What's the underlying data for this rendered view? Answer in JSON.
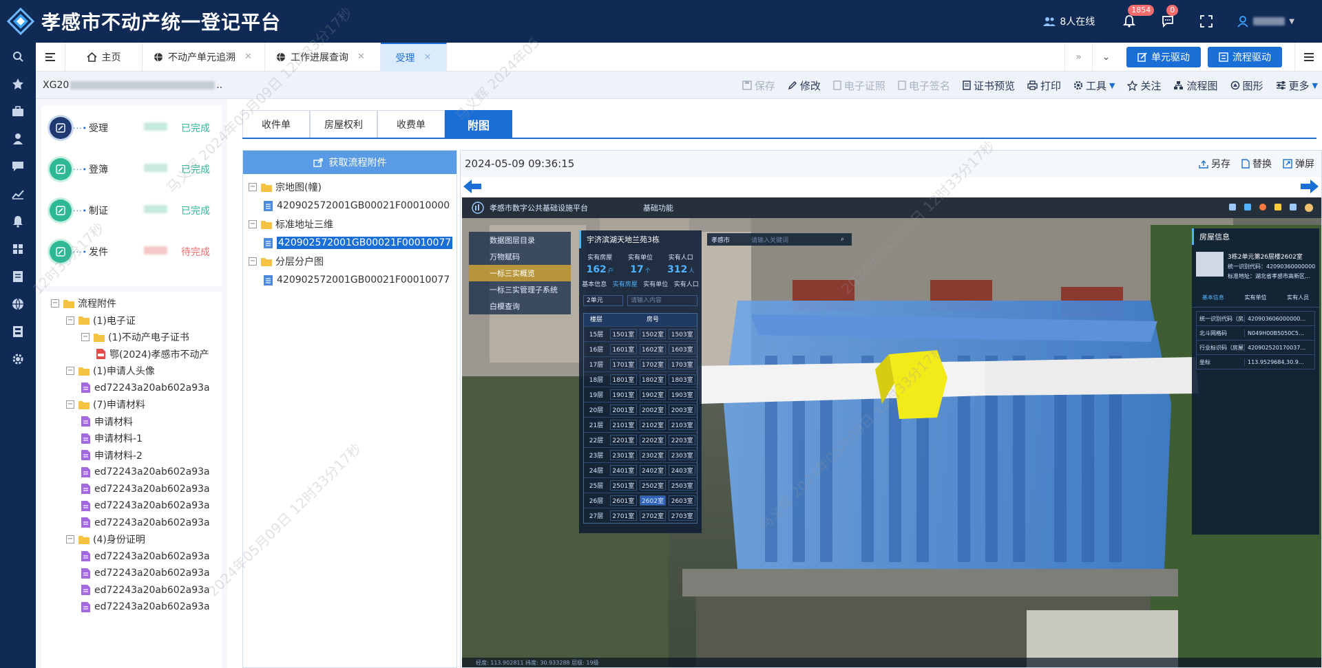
{
  "header": {
    "title": "孝感市不动产统一登记平台",
    "online": "8人在线",
    "notify_count": "1854",
    "message_count": "0"
  },
  "tabs": [
    {
      "label": "主页"
    },
    {
      "label": "不动产单元追溯"
    },
    {
      "label": "工作进展查询"
    },
    {
      "label": "受理"
    }
  ],
  "tab_buttons": {
    "unit_drive": "单元驱动",
    "flow_drive": "流程驱动"
  },
  "toolbar": {
    "case_prefix": "XG20",
    "case_suffix": "..",
    "save": "保存",
    "edit": "修改",
    "e_cert": "电子证照",
    "e_sign": "电子签名",
    "cert_preview": "证书预览",
    "print": "打印",
    "tools": "工具",
    "follow": "关注",
    "flowchart": "流程图",
    "shape": "图形",
    "more": "更多"
  },
  "flow_steps": [
    {
      "name": "受理",
      "status": "已完成",
      "state": "current"
    },
    {
      "name": "登簿",
      "status": "已完成",
      "state": "done"
    },
    {
      "name": "制证",
      "status": "已完成",
      "state": "done"
    },
    {
      "name": "发件",
      "status": "待完成",
      "state": "pending"
    }
  ],
  "attach_tree": [
    {
      "label": "流程附件",
      "level": 0,
      "type": "folder",
      "toggle": "-"
    },
    {
      "label": "(1)电子证",
      "level": 1,
      "type": "folder",
      "toggle": "-"
    },
    {
      "label": "(1)不动产电子证书",
      "level": 2,
      "type": "folder",
      "toggle": "-"
    },
    {
      "label": "鄂(2024)孝感市不动产",
      "level": 3,
      "type": "pdf"
    },
    {
      "label": "(1)申请人头像",
      "level": 1,
      "type": "folder",
      "toggle": "-"
    },
    {
      "label": "ed72243a20ab602a93a",
      "level": 2,
      "type": "doc"
    },
    {
      "label": "(7)申请材料",
      "level": 1,
      "type": "folder",
      "toggle": "-"
    },
    {
      "label": "申请材料",
      "level": 2,
      "type": "doc"
    },
    {
      "label": "申请材料-1",
      "level": 2,
      "type": "doc"
    },
    {
      "label": "申请材料-2",
      "level": 2,
      "type": "doc"
    },
    {
      "label": "ed72243a20ab602a93a",
      "level": 2,
      "type": "doc"
    },
    {
      "label": "ed72243a20ab602a93a",
      "level": 2,
      "type": "doc"
    },
    {
      "label": "ed72243a20ab602a93a",
      "level": 2,
      "type": "doc"
    },
    {
      "label": "ed72243a20ab602a93a",
      "level": 2,
      "type": "doc"
    },
    {
      "label": "(4)身份证明",
      "level": 1,
      "type": "folder",
      "toggle": "-"
    },
    {
      "label": "ed72243a20ab602a93a",
      "level": 2,
      "type": "doc"
    },
    {
      "label": "ed72243a20ab602a93a",
      "level": 2,
      "type": "doc"
    },
    {
      "label": "ed72243a20ab602a93a",
      "level": 2,
      "type": "doc"
    },
    {
      "label": "ed72243a20ab602a93a",
      "level": 2,
      "type": "doc"
    }
  ],
  "doc_tabs": [
    {
      "label": "收件单"
    },
    {
      "label": "房屋权利"
    },
    {
      "label": "收费单"
    },
    {
      "label": "附图"
    }
  ],
  "attach_panel": {
    "fetch_button": "获取流程附件",
    "tree": [
      {
        "label": "宗地图(幢)",
        "type": "folder",
        "level": 0
      },
      {
        "label": "420902572001GB00021F00010000",
        "type": "file",
        "level": 1
      },
      {
        "label": "标准地址三维",
        "type": "folder",
        "level": 0
      },
      {
        "label": "420902572001GB00021F00010077",
        "type": "file",
        "level": 1,
        "selected": true
      },
      {
        "label": "分层分户图",
        "type": "folder",
        "level": 0
      },
      {
        "label": "420902572001GB00021F00010077",
        "type": "file",
        "level": 1
      }
    ]
  },
  "viewer": {
    "timestamp": "2024-05-09 09:36:15",
    "save_as": "另存",
    "replace": "替换",
    "popout": "弹屏"
  },
  "scene": {
    "platform_title": "孝感市数字公共基础设施平台",
    "platform_menu": "基础功能",
    "city": "孝感市",
    "search_placeholder": "请输入关键词",
    "menu": [
      "数据图层目录",
      "万物赋码",
      "一标三实概览",
      "一标三实管理子系统",
      "白模查询"
    ],
    "panel_title": "宇济滨湖天地兰苑3栋",
    "stats": [
      {
        "label": "实有房屋",
        "value": "162",
        "unit": "户"
      },
      {
        "label": "实有单位",
        "value": "17",
        "unit": "个"
      },
      {
        "label": "实有人口",
        "value": "312",
        "unit": "人"
      }
    ],
    "subtabs": [
      "基本信息",
      "实有房屋",
      "实有单位",
      "实有人口"
    ],
    "unit_select": "2单元",
    "content_placeholder": "请输入内容",
    "table_headers": [
      "楼层",
      "房号"
    ],
    "floor_rows": [
      {
        "floor": "15层",
        "rooms": [
          "1501室",
          "1502室",
          "1503室"
        ]
      },
      {
        "floor": "16层",
        "rooms": [
          "1601室",
          "1602室",
          "1603室"
        ]
      },
      {
        "floor": "17层",
        "rooms": [
          "1701室",
          "1702室",
          "1703室"
        ]
      },
      {
        "floor": "18层",
        "rooms": [
          "1801室",
          "1802室",
          "1803室"
        ]
      },
      {
        "floor": "19层",
        "rooms": [
          "1901室",
          "1902室",
          "1903室"
        ]
      },
      {
        "floor": "20层",
        "rooms": [
          "2001室",
          "2002室",
          "2003室"
        ]
      },
      {
        "floor": "21层",
        "rooms": [
          "2101室",
          "2102室",
          "2103室"
        ]
      },
      {
        "floor": "22层",
        "rooms": [
          "2201室",
          "2202室",
          "2203室"
        ]
      },
      {
        "floor": "23层",
        "rooms": [
          "2301室",
          "2302室",
          "2303室"
        ]
      },
      {
        "floor": "24层",
        "rooms": [
          "2401室",
          "2402室",
          "2403室"
        ]
      },
      {
        "floor": "25层",
        "rooms": [
          "2501室",
          "2502室",
          "2503室"
        ]
      },
      {
        "floor": "26层",
        "rooms": [
          "2601室",
          "2602室",
          "2603室"
        ]
      },
      {
        "floor": "27层",
        "rooms": [
          "2701室",
          "2702室",
          "2703室"
        ]
      }
    ],
    "info_title": "房屋信息",
    "info_summary": "3栋2单元第26层楼2602室",
    "info_line1": "统一识别代码：420903600000000…",
    "info_line2": "标准地址：湖北省孝感市高新区…",
    "info_tabs": [
      "基本信息",
      "实有单位",
      "实有人员"
    ],
    "info_rows": [
      {
        "key": "统一识别代码（房屋）",
        "value": "420903606000000…"
      },
      {
        "key": "北斗网格码",
        "value": "N049H00B5050C5…"
      },
      {
        "key": "行业标识码（房屋）",
        "value": "420902520170037…"
      },
      {
        "key": "坐标",
        "value": "113.9529684,30.9…"
      }
    ],
    "status_bar": "经度: 113.902811  纬度: 30.933288  层级: 19级"
  },
  "watermarks": [
    "马义辉 2024年05月09日 12时33分17秒",
    "12时33分17秒",
    "马义辉 2024年05",
    "2024年05月09日 12时33分17秒"
  ],
  "colors": {
    "primary": "#1a6fd6",
    "header_bg": "#0f2a55",
    "done": "#2eb896",
    "pending": "#f56c6c",
    "highlight": "#f3ea1a"
  }
}
